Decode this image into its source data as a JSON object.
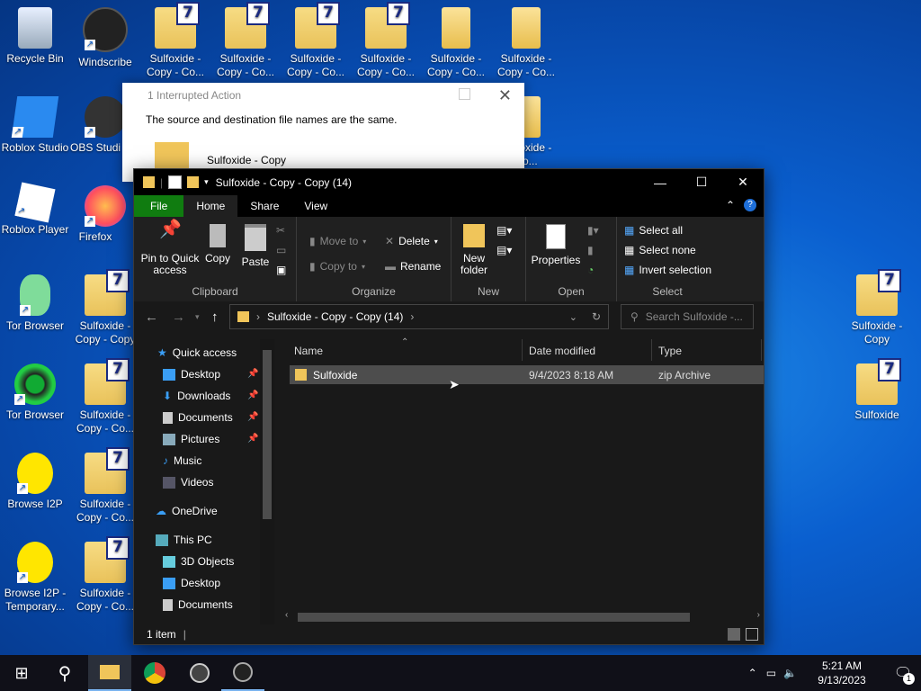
{
  "desktop": {
    "icons": [
      {
        "label": "Recycle Bin"
      },
      {
        "label": "Windscribe"
      },
      {
        "label": "Sulfoxide - Copy - Co..."
      },
      {
        "label": "Sulfoxide - Copy - Co..."
      },
      {
        "label": "Sulfoxide - Copy - Co..."
      },
      {
        "label": "Sulfoxide - Copy - Co..."
      },
      {
        "label": "Sulfoxide - Copy - Co..."
      },
      {
        "label": "Sulfoxide - Copy - Co..."
      },
      {
        "label": "Roblox Studio"
      },
      {
        "label": "OBS Studio"
      },
      {
        "label": "Roblox Player"
      },
      {
        "label": "Firefox"
      },
      {
        "label": "Tor Browser"
      },
      {
        "label": "Sulfoxide - Copy - Copy"
      },
      {
        "label": "Tor Browser"
      },
      {
        "label": "Sulfoxide - Copy - Co..."
      },
      {
        "label": "Browse I2P"
      },
      {
        "label": "Sulfoxide - Copy - Co..."
      },
      {
        "label": "Browse I2P - Temporary..."
      },
      {
        "label": "Sulfoxide - Copy - Co..."
      },
      {
        "label": "Sulfoxide - Copy"
      },
      {
        "label": "Sulfoxide"
      },
      {
        "label": "Sulfoxide - Co..."
      }
    ]
  },
  "dialog": {
    "title": "1 Interrupted Action",
    "message": "The source and destination file names are the same.",
    "file_name": "Sulfoxide - Copy"
  },
  "explorer": {
    "title": "Sulfoxide - Copy - Copy (14)",
    "tabs": {
      "file": "File",
      "home": "Home",
      "share": "Share",
      "view": "View"
    },
    "ribbon": {
      "pin_label": "Pin to Quick access",
      "copy_label": "Copy",
      "paste_label": "Paste",
      "clipboard_group": "Clipboard",
      "move_to": "Move to",
      "copy_to": "Copy to",
      "delete": "Delete",
      "rename": "Rename",
      "organize_group": "Organize",
      "new_folder": "New folder",
      "new_group": "New",
      "properties": "Properties",
      "open_group": "Open",
      "select_all": "Select all",
      "select_none": "Select none",
      "invert_selection": "Invert selection",
      "select_group": "Select"
    },
    "address": "Sulfoxide - Copy - Copy (14)",
    "search_placeholder": "Search Sulfoxide -...",
    "sidebar": {
      "quick_access": "Quick access",
      "desktop": "Desktop",
      "downloads": "Downloads",
      "documents": "Documents",
      "pictures": "Pictures",
      "music": "Music",
      "videos": "Videos",
      "onedrive": "OneDrive",
      "this_pc": "This PC",
      "objects3d": "3D Objects",
      "desktop2": "Desktop",
      "documents2": "Documents"
    },
    "columns": {
      "name": "Name",
      "date": "Date modified",
      "type": "Type"
    },
    "files": [
      {
        "name": "Sulfoxide",
        "date": "9/4/2023 8:18 AM",
        "type": "zip Archive"
      }
    ],
    "status": "1 item"
  },
  "taskbar": {
    "time": "5:21 AM",
    "date": "9/13/2023",
    "notification_count": "1"
  },
  "colors": {
    "accent": "#107c10",
    "desktop": "#0a5fcf",
    "explorer_bg": "#191919"
  }
}
